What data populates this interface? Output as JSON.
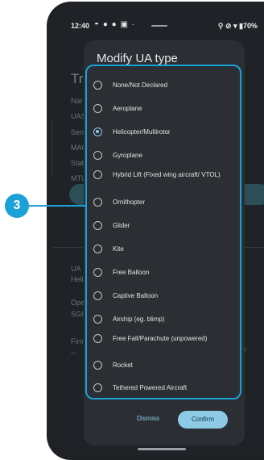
{
  "status_bar": {
    "time": "12:40",
    "left_icons": "◓ ● ● ▣ ·",
    "right_icons": "⚲ ⊘ ▾ ▮70%"
  },
  "background": {
    "title": "Tra",
    "labels": [
      "Nar",
      "UAS",
      "Seri",
      "MAC",
      "Stat",
      "MTU",
      "UA",
      "Heli",
      "Ope",
      "SGI",
      "Firm",
      "--"
    ],
    "right_fragment": "ar"
  },
  "dialog": {
    "title": "Modify UA type",
    "options": [
      {
        "label": "None/Not Declared",
        "selected": false
      },
      {
        "label": "Aeroplane",
        "selected": false
      },
      {
        "label": "Helicopter/Multirotor",
        "selected": true
      },
      {
        "label": "Gyroplane",
        "selected": false
      },
      {
        "label": "Hybrid Lift (Fixed wing aircraft/ VTOL)",
        "selected": false
      },
      {
        "label": "Ornithopter",
        "selected": false
      },
      {
        "label": "Glider",
        "selected": false
      },
      {
        "label": "Kite",
        "selected": false
      },
      {
        "label": "Free Balloon",
        "selected": false
      },
      {
        "label": "Captive Balloon",
        "selected": false
      },
      {
        "label": "Airship (eg. blimp)",
        "selected": false
      },
      {
        "label": "Free Fall/Parachute (unpowered)",
        "selected": false
      },
      {
        "label": "Rocket",
        "selected": false
      },
      {
        "label": "Tethered Powered Aircraft",
        "selected": false
      }
    ],
    "dismiss_label": "Dismiss",
    "confirm_label": "Confirm"
  },
  "annotation": {
    "badge_number": "3",
    "color": "#1aa1d8"
  },
  "colors": {
    "accent": "#8ecae6",
    "dialog_bg": "#2b2e33"
  }
}
